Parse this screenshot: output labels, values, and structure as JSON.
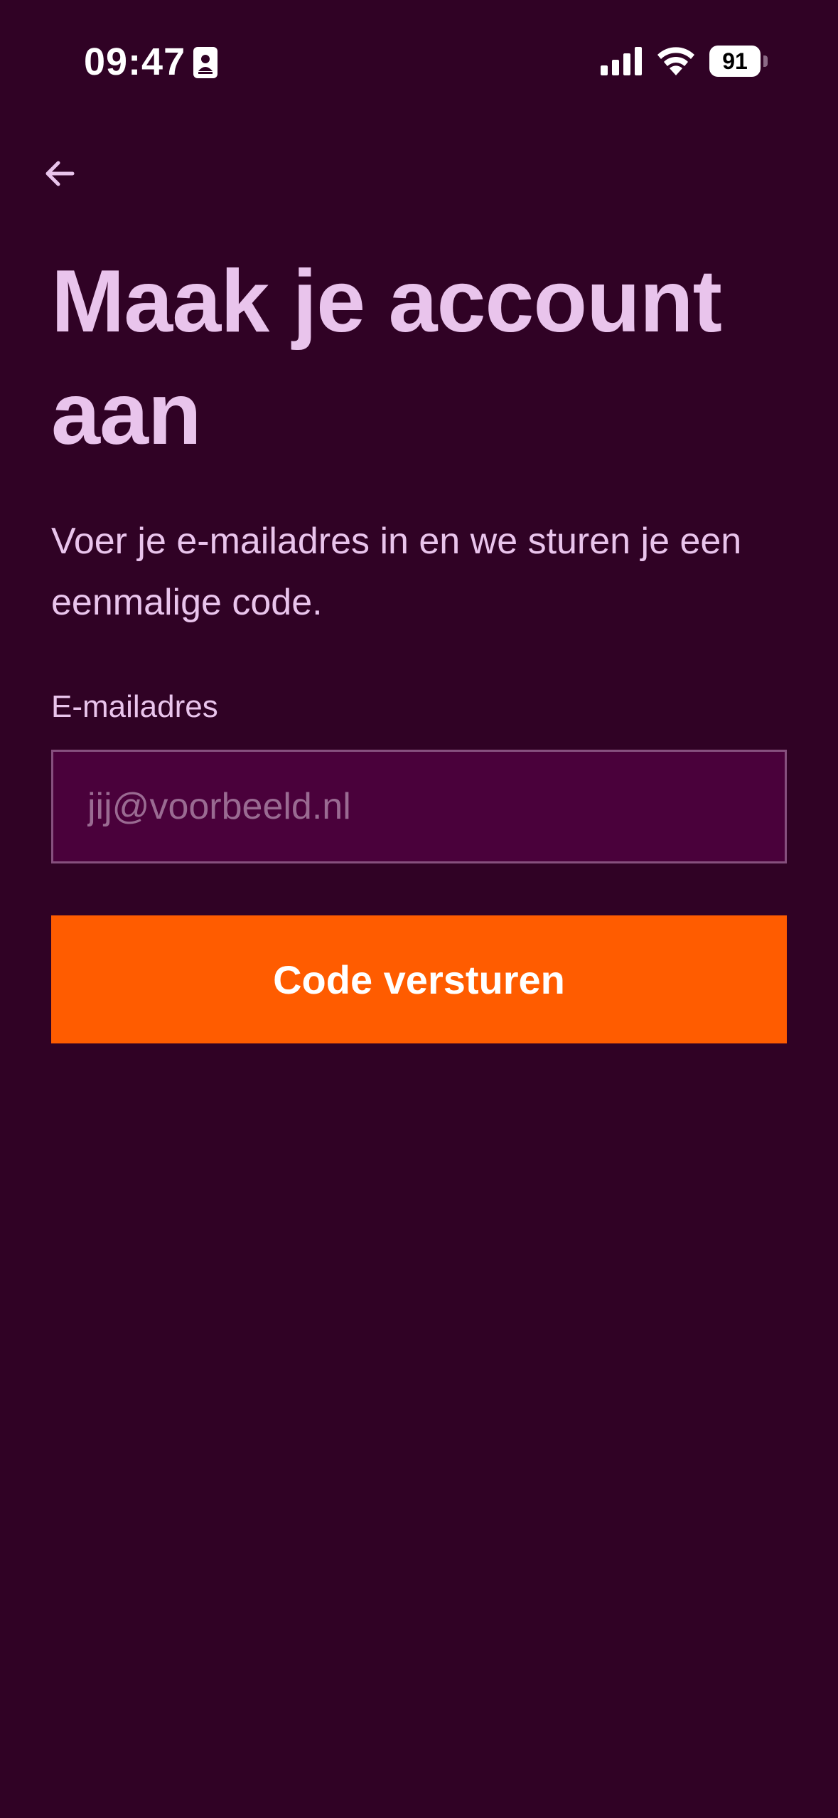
{
  "status_bar": {
    "time": "09:47",
    "battery_level": "91",
    "icons": [
      "id-badge-icon",
      "cellular-signal-icon",
      "wifi-icon",
      "battery-icon"
    ]
  },
  "navigation": {
    "back_icon": "arrow-left-icon"
  },
  "main": {
    "title": "Maak je account aan",
    "subtitle": "Voer je e-mailadres in en we sturen je een eenmalige code.",
    "email_label": "E-mailadres",
    "email_value": "",
    "email_placeholder": "jij@voorbeeld.nl",
    "submit_label": "Code versturen"
  },
  "colors": {
    "background": "#300225",
    "text": "#e9c4ec",
    "input_background": "#4a013b",
    "input_border": "#86507e",
    "placeholder": "#9a6b92",
    "accent": "#ff5c00",
    "button_text": "#ffffff"
  }
}
